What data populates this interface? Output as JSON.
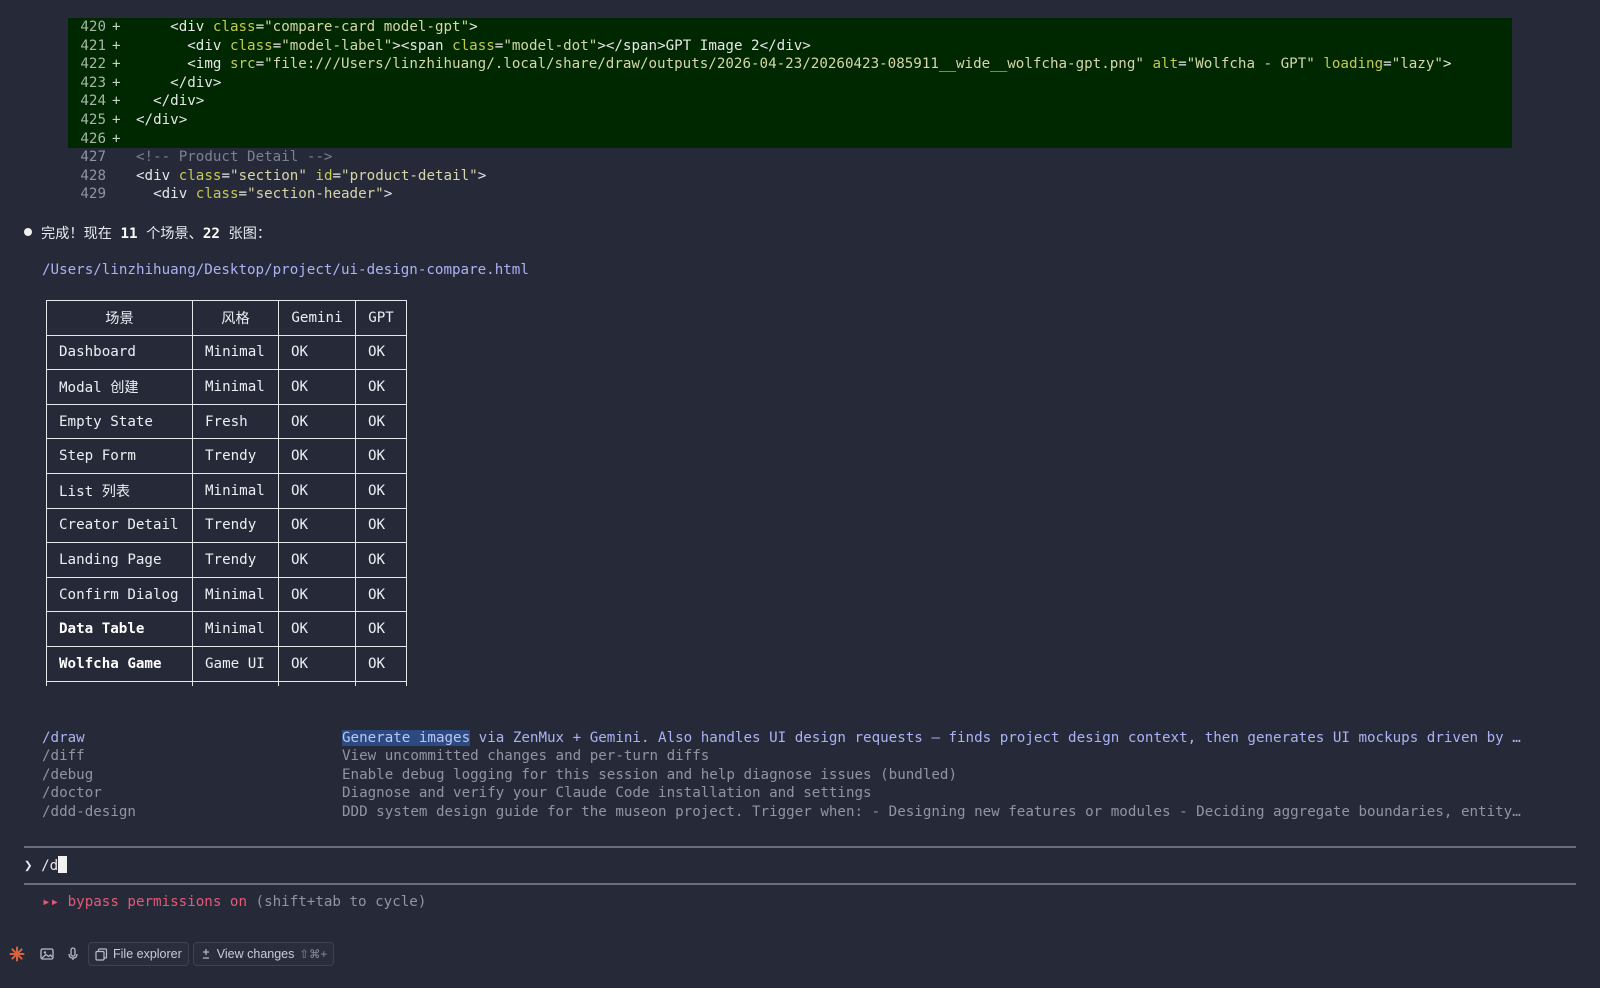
{
  "diff": {
    "added_lines": [
      {
        "num": "420",
        "mark": "+",
        "parts": [
          [
            "t-txt",
            "    <div "
          ],
          [
            "t-attr",
            "class"
          ],
          [
            "t-txt",
            "="
          ],
          [
            "t-str",
            "\"compare-card model-gpt\""
          ],
          [
            "t-txt",
            ">"
          ]
        ]
      },
      {
        "num": "421",
        "mark": "+",
        "parts": [
          [
            "t-txt",
            "      <div "
          ],
          [
            "t-attr",
            "class"
          ],
          [
            "t-txt",
            "="
          ],
          [
            "t-str",
            "\"model-label\""
          ],
          [
            "t-txt",
            "><span "
          ],
          [
            "t-attr",
            "class"
          ],
          [
            "t-txt",
            "="
          ],
          [
            "t-str",
            "\"model-dot\""
          ],
          [
            "t-txt",
            "></span>GPT Image 2</div>"
          ]
        ]
      },
      {
        "num": "422",
        "mark": "+",
        "parts": [
          [
            "t-txt",
            "      <img "
          ],
          [
            "t-attr",
            "src"
          ],
          [
            "t-txt",
            "="
          ],
          [
            "t-str",
            "\"file:///Users/linzhihuang/.local/share/draw/outputs/2026-04-23/20260423-085911__wide__wolfcha-gpt.png\""
          ],
          [
            "t-txt",
            " "
          ],
          [
            "t-attr",
            "alt"
          ],
          [
            "t-txt",
            "="
          ],
          [
            "t-str",
            "\"Wolfcha - GPT\""
          ],
          [
            "t-txt",
            " "
          ],
          [
            "t-attr",
            "loading"
          ],
          [
            "t-txt",
            "="
          ],
          [
            "t-str",
            "\"lazy\""
          ],
          [
            "t-txt",
            ">"
          ]
        ]
      },
      {
        "num": "423",
        "mark": "+",
        "parts": [
          [
            "t-txt",
            "    </div>"
          ]
        ]
      },
      {
        "num": "424",
        "mark": "+",
        "parts": [
          [
            "t-txt",
            "  </div>"
          ]
        ]
      },
      {
        "num": "425",
        "mark": "+",
        "parts": [
          [
            "t-txt",
            "</div>"
          ]
        ]
      },
      {
        "num": "426",
        "mark": "+",
        "parts": [
          [
            "t-txt",
            ""
          ]
        ]
      }
    ],
    "context_lines": [
      {
        "num": "427",
        "parts": [
          [
            "t-cmt",
            "<!-- Product Detail -->"
          ]
        ]
      },
      {
        "num": "428",
        "parts": [
          [
            "t-txt",
            "<div "
          ],
          [
            "t-attr",
            "class"
          ],
          [
            "t-txt",
            "="
          ],
          [
            "t-str",
            "\"section\""
          ],
          [
            "t-txt",
            " "
          ],
          [
            "t-attr",
            "id"
          ],
          [
            "t-txt",
            "="
          ],
          [
            "t-str",
            "\"product-detail\""
          ],
          [
            "t-txt",
            ">"
          ]
        ]
      },
      {
        "num": "429",
        "parts": [
          [
            "t-txt",
            "  <div "
          ],
          [
            "t-attr",
            "class"
          ],
          [
            "t-txt",
            "="
          ],
          [
            "t-str",
            "\"section-header\""
          ],
          [
            "t-txt",
            ">"
          ]
        ]
      }
    ]
  },
  "response": {
    "pre": "完成！现在 ",
    "scene_count": "11",
    "mid": " 个场景、",
    "image_count": "22",
    "post": " 张图：",
    "file_path": "/Users/linzhihuang/Desktop/project/ui-design-compare.html"
  },
  "table": {
    "headers": [
      "场景",
      "风格",
      "Gemini",
      "GPT"
    ],
    "rows": [
      {
        "scene": "Dashboard",
        "style": "Minimal",
        "gemini": "OK",
        "gpt": "OK",
        "bold": false
      },
      {
        "scene": "Modal 创建",
        "style": "Minimal",
        "gemini": "OK",
        "gpt": "OK",
        "bold": false
      },
      {
        "scene": "Empty State",
        "style": "Fresh",
        "gemini": "OK",
        "gpt": "OK",
        "bold": false
      },
      {
        "scene": "Step Form",
        "style": "Trendy",
        "gemini": "OK",
        "gpt": "OK",
        "bold": false
      },
      {
        "scene": "List 列表",
        "style": "Minimal",
        "gemini": "OK",
        "gpt": "OK",
        "bold": false
      },
      {
        "scene": "Creator Detail",
        "style": "Trendy",
        "gemini": "OK",
        "gpt": "OK",
        "bold": false
      },
      {
        "scene": "Landing Page",
        "style": "Trendy",
        "gemini": "OK",
        "gpt": "OK",
        "bold": false
      },
      {
        "scene": "Confirm Dialog",
        "style": "Minimal",
        "gemini": "OK",
        "gpt": "OK",
        "bold": false
      },
      {
        "scene": "Data Table",
        "style": "Minimal",
        "gemini": "OK",
        "gpt": "OK",
        "bold": true
      },
      {
        "scene": "Wolfcha Game",
        "style": "Game UI",
        "gemini": "OK",
        "gpt": "OK",
        "bold": true
      }
    ]
  },
  "commands": [
    {
      "name": "/draw",
      "desc_highlight": "Generate images",
      "desc": " via ZenMux + Gemini. Also handles UI design requests — finds project design context, then generates UI mockups driven by …",
      "selected": true
    },
    {
      "name": "/diff",
      "desc_highlight": "",
      "desc": "View uncommitted changes and per-turn diffs",
      "selected": false
    },
    {
      "name": "/debug",
      "desc_highlight": "",
      "desc": "Enable debug logging for this session and help diagnose issues (bundled)",
      "selected": false
    },
    {
      "name": "/doctor",
      "desc_highlight": "",
      "desc": "Diagnose and verify your Claude Code installation and settings",
      "selected": false
    },
    {
      "name": "/ddd-design",
      "desc_highlight": "",
      "desc": "DDD system design guide for the museon project. Trigger when: - Designing new features or modules - Deciding aggregate boundaries, entity…",
      "selected": false
    }
  ],
  "prompt": {
    "symbol": "❯",
    "input_value": "/d"
  },
  "mode": {
    "arrows": "▸▸",
    "text": "bypass permissions on",
    "hint": " (shift+tab to cycle)"
  },
  "toolbar": {
    "file_explorer": "File explorer",
    "view_changes": "View changes",
    "view_changes_shortcut": "⇧⌘+"
  },
  "colors": {
    "background": "#262a38",
    "diff_added_bg": "#002800",
    "accent": "#a9b3f3",
    "mode": "#e35a78"
  }
}
